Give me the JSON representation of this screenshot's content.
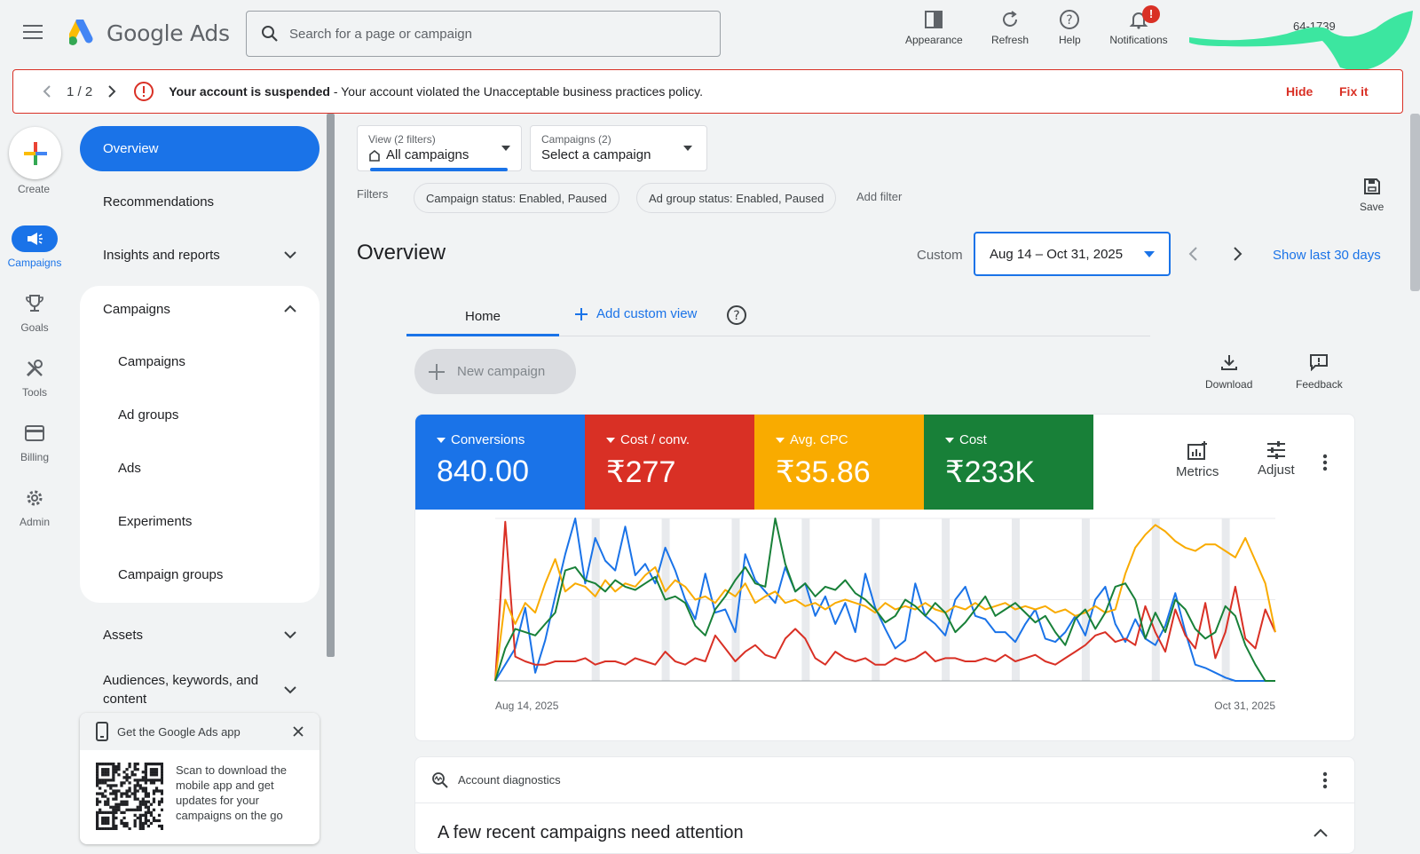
{
  "header": {
    "app_name": "Google Ads",
    "search_placeholder": "Search for a page or campaign",
    "actions": [
      {
        "label": "Appearance",
        "icon": "appearance-icon"
      },
      {
        "label": "Refresh",
        "icon": "refresh-icon"
      },
      {
        "label": "Help",
        "icon": "help-icon"
      },
      {
        "label": "Notifications",
        "icon": "bell-icon",
        "badge": "!"
      }
    ],
    "account_number_fragment": "64-1739",
    "redaction_color": "#3ce6a0"
  },
  "banner": {
    "pager": "1 / 2",
    "title": "Your account is suspended",
    "message": " - Your account violated the Unacceptable business practices policy.",
    "hide_label": "Hide",
    "fix_label": "Fix it"
  },
  "rail": {
    "create_label": "Create",
    "items": [
      {
        "label": "Campaigns",
        "icon": "megaphone-icon",
        "active": true
      },
      {
        "label": "Goals",
        "icon": "trophy-icon"
      },
      {
        "label": "Tools",
        "icon": "tools-icon"
      },
      {
        "label": "Billing",
        "icon": "credit-card-icon"
      },
      {
        "label": "Admin",
        "icon": "gear-icon"
      }
    ]
  },
  "nav": {
    "overview": "Overview",
    "recommendations": "Recommendations",
    "insights": "Insights and reports",
    "campaigns_group": "Campaigns",
    "campaign_items": [
      "Campaigns",
      "Ad groups",
      "Ads",
      "Experiments",
      "Campaign groups"
    ],
    "assets": "Assets",
    "audiences_line1": "Audiences, keywords, and",
    "audiences_line2": "content"
  },
  "app_promo": {
    "title": "Get the Google Ads app",
    "text": [
      "Scan to download the",
      "mobile app and get",
      "updates for your",
      "campaigns on the go"
    ]
  },
  "filters_bar": {
    "view_small": "View (2 filters)",
    "view_value": "All campaigns",
    "campaigns_small": "Campaigns (2)",
    "campaigns_value": "Select a campaign",
    "filters_label": "Filters",
    "chips": [
      "Campaign status: Enabled, Paused",
      "Ad group status: Enabled, Paused"
    ],
    "add_filter": "Add filter",
    "save_label": "Save"
  },
  "overview": {
    "title": "Overview",
    "custom_label": "Custom",
    "date_range": "Aug 14 – Oct 31, 2025",
    "show_last": "Show last 30 days",
    "tab_home": "Home",
    "add_custom_view": "Add custom view",
    "new_campaign": "New campaign",
    "download": "Download",
    "feedback": "Feedback"
  },
  "metrics": [
    {
      "label": "Conversions",
      "value": "840.00",
      "color": "#1a73e8"
    },
    {
      "label": "Cost / conv.",
      "value": "₹277",
      "color": "#d93025"
    },
    {
      "label": "Avg. CPC",
      "value": "₹35.86",
      "color": "#f9ab00"
    },
    {
      "label": "Cost",
      "value": "₹233K",
      "color": "#188038"
    }
  ],
  "metric_tools": {
    "metrics": "Metrics",
    "adjust": "Adjust"
  },
  "chart_data": {
    "type": "line",
    "x_start_label": "Aug 14, 2025",
    "x_end_label": "Oct 31, 2025",
    "points": 79,
    "y_normalized_range": [
      0,
      100
    ],
    "series": [
      {
        "key": "conversions",
        "color": "#1a73e8",
        "values": [
          0,
          10,
          20,
          45,
          5,
          25,
          52,
          78,
          100,
          60,
          88,
          74,
          68,
          95,
          65,
          72,
          60,
          82,
          68,
          50,
          38,
          66,
          42,
          44,
          30,
          78,
          62,
          55,
          48,
          70,
          55,
          60,
          40,
          52,
          35,
          48,
          30,
          66,
          45,
          32,
          20,
          25,
          60,
          40,
          35,
          28,
          50,
          58,
          40,
          38,
          30,
          30,
          24,
          35,
          44,
          26,
          24,
          30,
          40,
          28,
          50,
          58,
          35,
          24,
          38,
          26,
          22,
          34,
          54,
          30,
          10,
          8,
          5,
          2,
          0,
          0,
          0,
          0,
          0
        ]
      },
      {
        "key": "cost_per_conv",
        "color": "#d93025",
        "values": [
          0,
          98,
          15,
          12,
          10,
          10,
          12,
          12,
          12,
          14,
          10,
          12,
          12,
          10,
          14,
          12,
          10,
          18,
          12,
          10,
          14,
          12,
          28,
          20,
          12,
          18,
          22,
          16,
          14,
          26,
          32,
          26,
          14,
          10,
          18,
          14,
          12,
          14,
          10,
          10,
          14,
          12,
          14,
          18,
          12,
          14,
          14,
          12,
          12,
          14,
          12,
          16,
          12,
          14,
          16,
          12,
          10,
          14,
          18,
          22,
          28,
          30,
          24,
          26,
          22,
          46,
          30,
          18,
          44,
          28,
          20,
          48,
          14,
          30,
          58,
          26,
          20,
          44,
          30,
          8,
          0,
          0,
          0,
          0,
          0,
          0,
          0,
          0,
          0,
          0,
          0,
          0,
          0,
          0,
          0,
          0
        ]
      },
      {
        "key": "avg_cpc",
        "color": "#f9ab00",
        "values": [
          0,
          50,
          35,
          48,
          42,
          60,
          75,
          55,
          60,
          58,
          52,
          62,
          55,
          60,
          58,
          65,
          70,
          55,
          62,
          58,
          50,
          52,
          48,
          56,
          52,
          60,
          48,
          52,
          55,
          48,
          50,
          46,
          48,
          44,
          48,
          50,
          48,
          46,
          42,
          48,
          44,
          46,
          44,
          48,
          44,
          42,
          46,
          44,
          48,
          44,
          46,
          48,
          44,
          46,
          44,
          46,
          42,
          44,
          40,
          42,
          46,
          42,
          44,
          66,
          82,
          90,
          96,
          92,
          86,
          82,
          80,
          84,
          84,
          80,
          76,
          88,
          74,
          60,
          30,
          5,
          0,
          0,
          0
        ]
      },
      {
        "key": "cost",
        "color": "#188038",
        "values": [
          0,
          20,
          32,
          30,
          28,
          35,
          42,
          68,
          70,
          62,
          60,
          55,
          62,
          58,
          56,
          60,
          64,
          50,
          52,
          48,
          34,
          28,
          44,
          52,
          62,
          70,
          60,
          58,
          100,
          72,
          55,
          60,
          52,
          58,
          56,
          62,
          54,
          50,
          44,
          36,
          40,
          50,
          46,
          40,
          48,
          42,
          30,
          36,
          44,
          52,
          40,
          44,
          48,
          42,
          36,
          40,
          30,
          22,
          38,
          44,
          32,
          42,
          58,
          60,
          50,
          26,
          42,
          30,
          50,
          44,
          32,
          26,
          30,
          46,
          40,
          22,
          10,
          0,
          0,
          0,
          0,
          0
        ]
      }
    ]
  },
  "diagnostics": {
    "label": "Account diagnostics",
    "heading": "A few recent campaigns need attention"
  }
}
